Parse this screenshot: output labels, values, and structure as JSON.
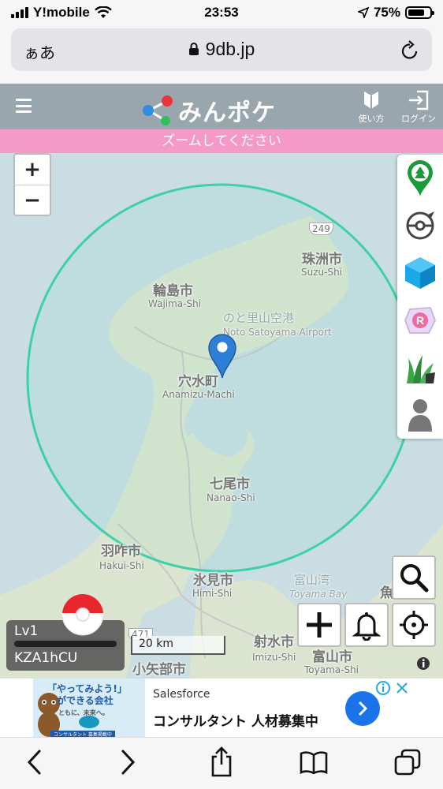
{
  "status_bar": {
    "carrier": "Y!mobile",
    "time": "23:53",
    "battery": "75%",
    "battery_level": 0.75
  },
  "browser": {
    "aa_label": "ぁあ",
    "url": "9db.jp"
  },
  "header": {
    "logo_text": "みんポケ",
    "guide_label": "使い方",
    "login_label": "ログイン"
  },
  "banner": {
    "text": "ズームしてください"
  },
  "map": {
    "zoom_in": "+",
    "zoom_out": "−",
    "labels": {
      "suzu_jp": "珠洲市",
      "suzu_en": "Suzu-Shi",
      "wajima_jp": "輪島市",
      "wajima_en": "Wajima-Shi",
      "airport_jp": "のと里山空港",
      "airport_en": "Noto Satoyama Airport",
      "anamizu_jp": "穴水町",
      "anamizu_en": "Anamizu-Machi",
      "nanao_jp": "七尾市",
      "nanao_en": "Nanao-Shi",
      "hakui_jp": "羽咋市",
      "hakui_en": "Hakui-Shi",
      "himi_jp": "氷見市",
      "himi_en": "Himi-Shi",
      "toyamawan_jp": "富山湾",
      "toyamawan_en": "Toyama Bay",
      "imizu_jp": "射水市",
      "imizu_en": "Imizu-Shi",
      "toyama_jp": "富山市",
      "toyama_en": "Toyama-Shi",
      "oyabe_jp": "小矢部市",
      "uo_jp": "魚",
      "route_249": "249",
      "route_471": "471"
    },
    "scale": "20 km"
  },
  "player": {
    "level": "Lv1",
    "name": "KZA1hCU"
  },
  "ad": {
    "image_text_1": "「やってみよう!」",
    "image_text_2": "ができる会社",
    "image_text_3": "ともに、未来へ。",
    "image_caption": "コンサルタント 募集掲載中",
    "brand": "Salesforce",
    "title": "コンサルタント 人材募集中"
  },
  "colors": {
    "header_bg": "#9aa6ad",
    "banner_bg": "#f59ac7",
    "circle": "#3fd0a8",
    "marker": "#2f7fd6"
  }
}
